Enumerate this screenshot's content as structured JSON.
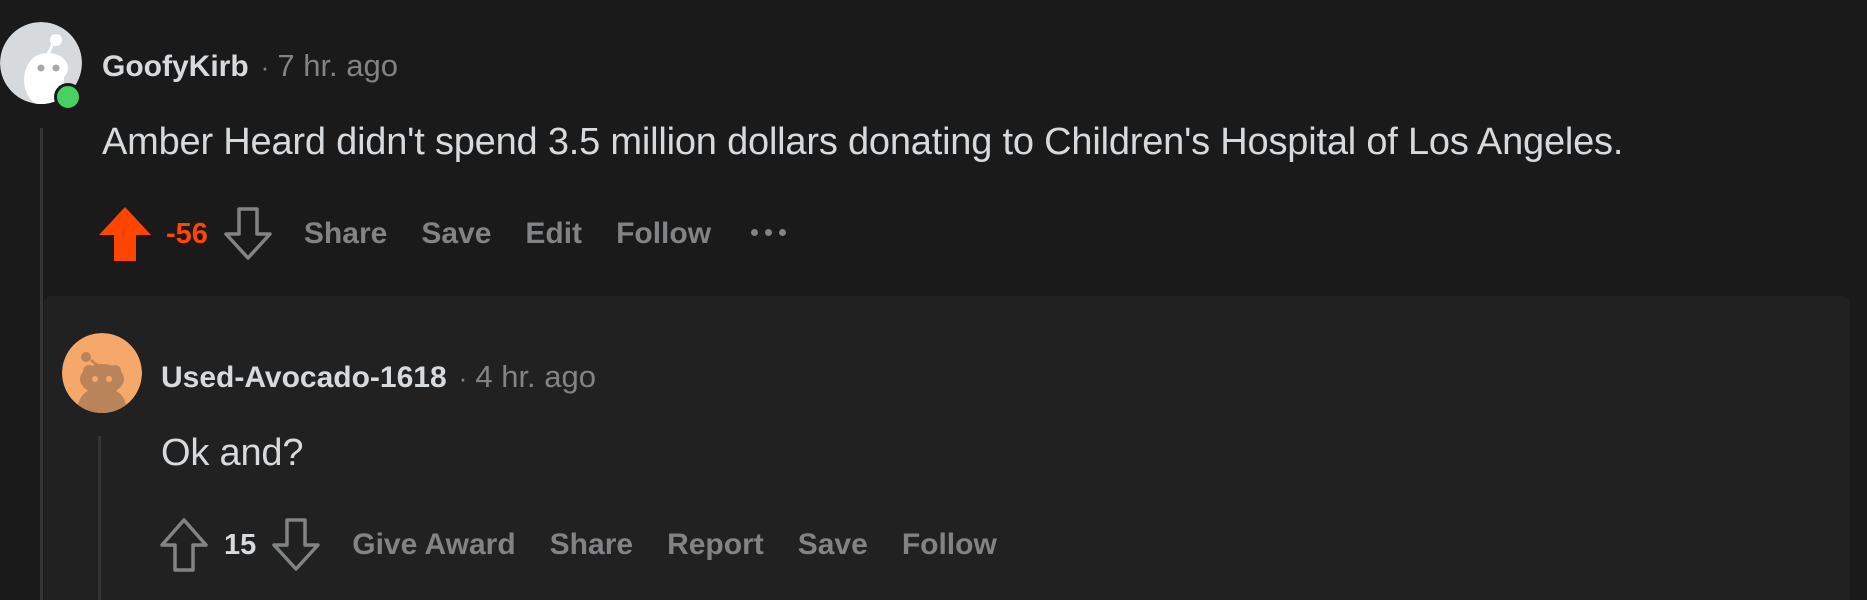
{
  "comment": {
    "author": "GoofyKirb",
    "separator": "·",
    "time": "7 hr. ago",
    "body": "Amber Heard didn't spend 3.5 million dollars donating to Children's Hospital of Los Angeles.",
    "score": "-56",
    "vote_state": "upvoted",
    "actions": {
      "share": "Share",
      "save": "Save",
      "edit": "Edit",
      "follow": "Follow"
    },
    "online": true
  },
  "reply": {
    "author": "Used-Avocado-1618",
    "separator": "·",
    "time": "4 hr. ago",
    "body": "Ok and?",
    "score": "15",
    "actions": {
      "give_award": "Give Award",
      "share": "Share",
      "report": "Report",
      "save": "Save",
      "follow": "Follow"
    }
  },
  "colors": {
    "background": "#1a1a1b",
    "reply_background": "#212122",
    "upvote_orange": "#ff4500",
    "muted_text": "#818384",
    "primary_text": "#d7dadc",
    "online_green": "#46d160",
    "avatar_reply_bg": "#f5a86a"
  },
  "icons": {
    "upvote_filled": "arrow-up-filled-icon",
    "upvote_outline": "arrow-up-outline-icon",
    "downvote_outline": "arrow-down-outline-icon",
    "more": "ellipsis-icon"
  }
}
